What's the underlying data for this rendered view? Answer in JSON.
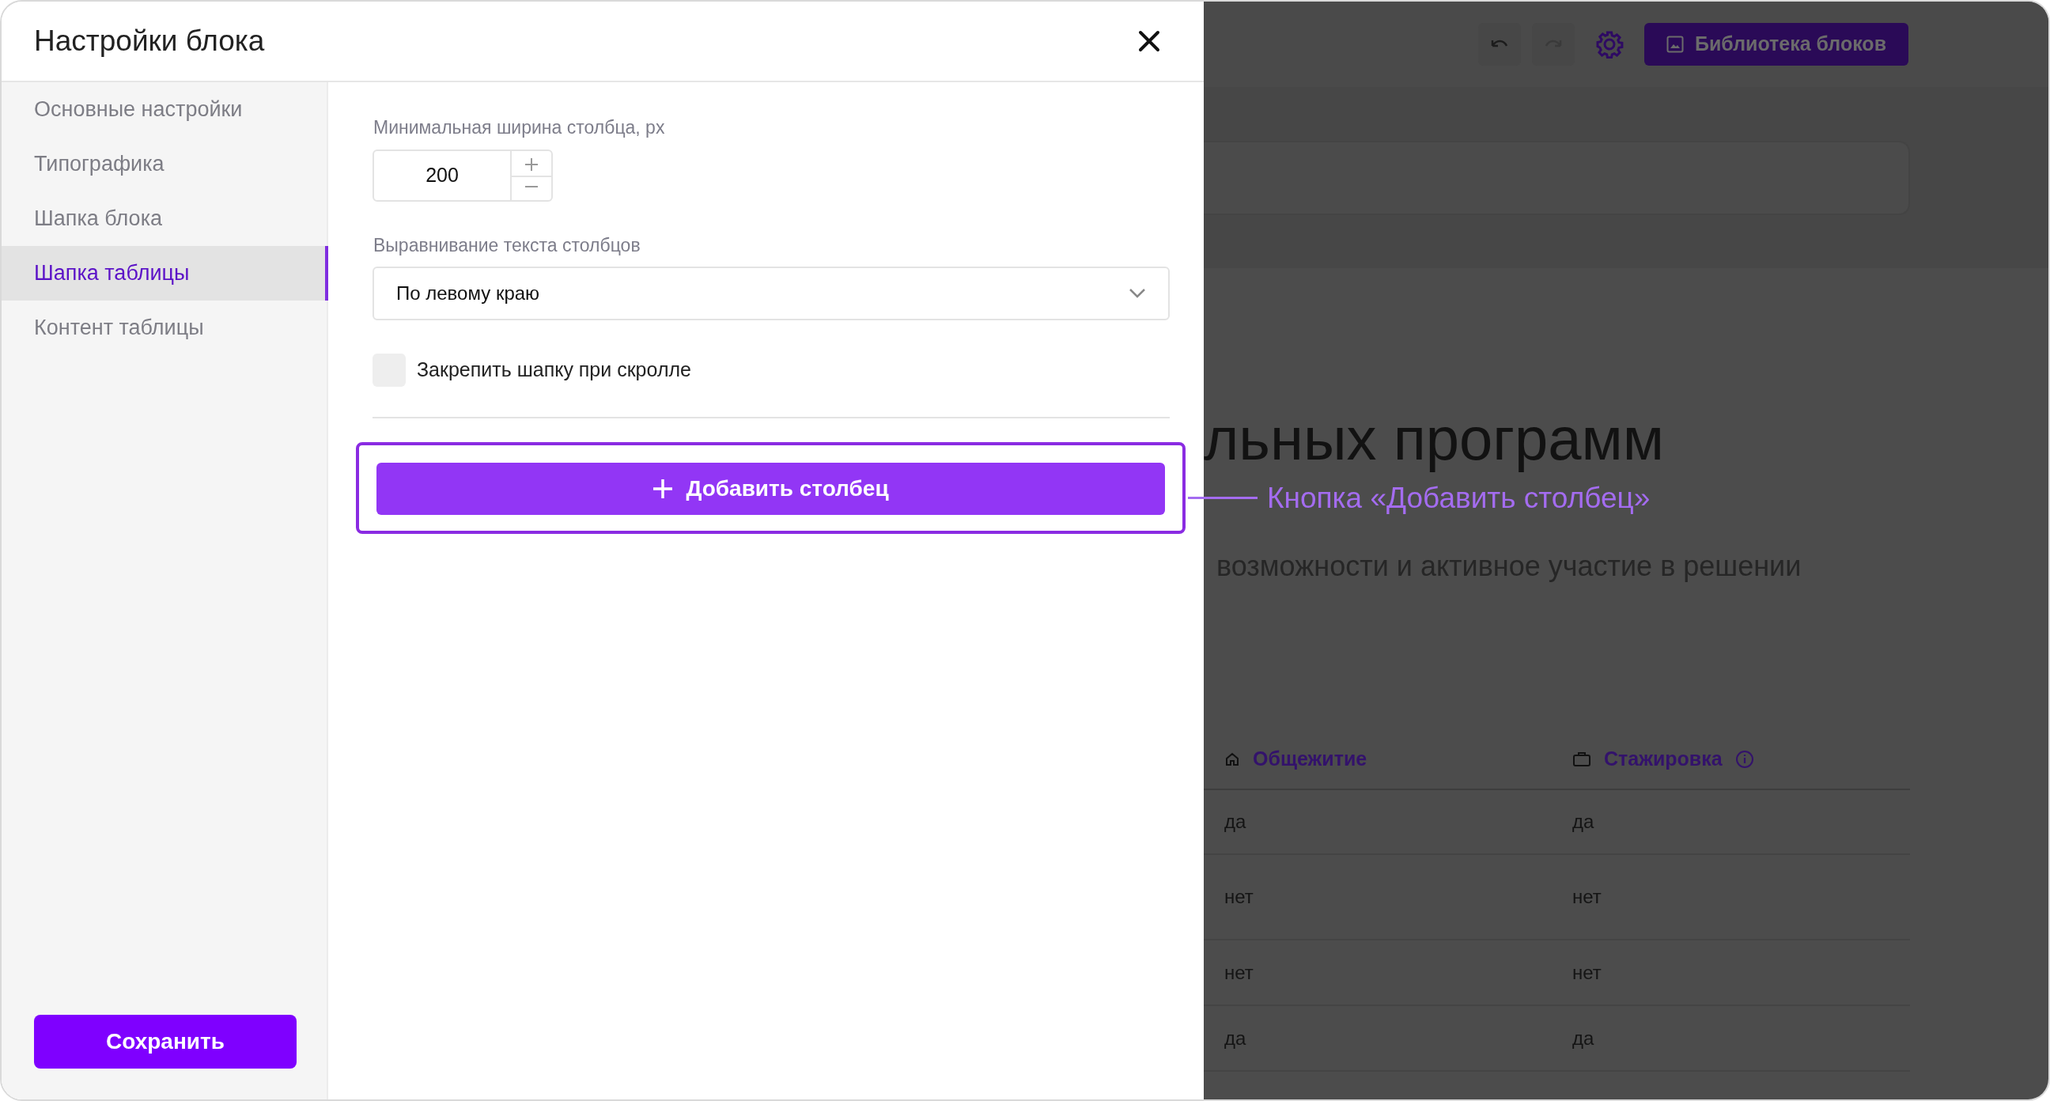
{
  "dialog": {
    "title": "Настройки блока"
  },
  "sidebar": {
    "items": [
      {
        "label": "Основные настройки",
        "selected": false
      },
      {
        "label": "Типографика",
        "selected": false
      },
      {
        "label": "Шапка блока",
        "selected": false
      },
      {
        "label": "Шапка таблицы",
        "selected": true
      },
      {
        "label": "Контент таблицы",
        "selected": false
      }
    ]
  },
  "min_width": {
    "label": "Минимальная ширина столбца, px",
    "value": "200"
  },
  "alignment": {
    "label": "Выравнивание текста столбцов",
    "value": "По левому краю"
  },
  "sticky_header": {
    "label": "Закрепить шапку при скролле",
    "checked": false
  },
  "add_column_button": {
    "label": "Добавить столбец",
    "highlighted": true
  },
  "save_button": {
    "label": "Сохранить"
  },
  "annotation": {
    "text": "Кнопка «Добавить столбец»"
  },
  "background_page": {
    "library_button": {
      "label": "Библиотека блоков"
    },
    "heading": "льных программ",
    "subtitle": "возможности и активное участие в решении",
    "table": {
      "columns": [
        {
          "label": "Общежитие",
          "info": false
        },
        {
          "label": "Стажировка",
          "info": true
        }
      ],
      "rows": [
        [
          "да",
          "да"
        ],
        [
          "нет",
          "нет"
        ],
        [
          "нет",
          "нет"
        ],
        [
          "да",
          "да"
        ]
      ]
    }
  }
}
